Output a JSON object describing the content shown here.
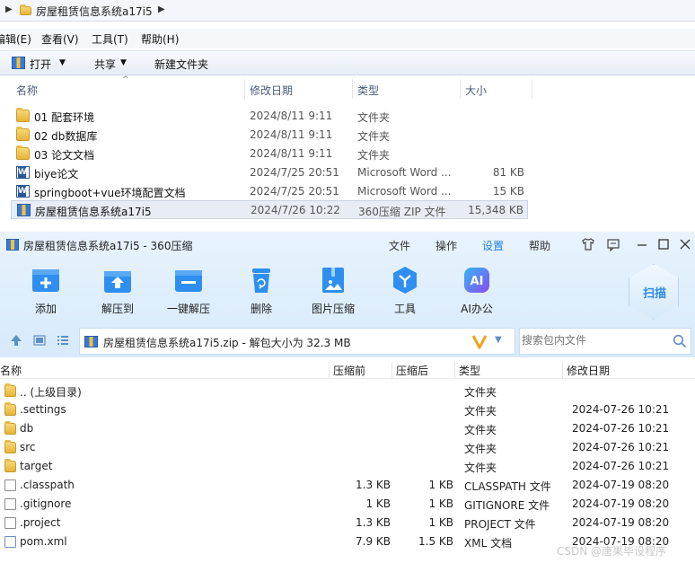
{
  "explorer": {
    "breadcrumb": "房屋租赁信息系统a17i5",
    "menu": [
      "编辑(E)",
      "查看(V)",
      "工具(T)",
      "帮助(H)"
    ],
    "toolbar": {
      "open": "打开",
      "share": "共享",
      "new_folder": "新建文件夹"
    },
    "columns": {
      "name": "名称",
      "date": "修改日期",
      "type": "类型",
      "size": "大小"
    },
    "rows": [
      {
        "icon": "folder",
        "name": "01 配套环境",
        "date": "2024/8/11 9:11",
        "type": "文件夹",
        "size": ""
      },
      {
        "icon": "folder",
        "name": "02 db数据库",
        "date": "2024/8/11 9:11",
        "type": "文件夹",
        "size": ""
      },
      {
        "icon": "folder",
        "name": "03 论文文档",
        "date": "2024/8/11 9:11",
        "type": "文件夹",
        "size": ""
      },
      {
        "icon": "word",
        "name": "biye论文",
        "date": "2024/7/25 20:51",
        "type": "Microsoft Word ...",
        "size": "81 KB"
      },
      {
        "icon": "word",
        "name": "springboot+vue环境配置文档",
        "date": "2024/7/25 20:51",
        "type": "Microsoft Word ...",
        "size": "15 KB"
      },
      {
        "icon": "zip",
        "name": "房屋租赁信息系统a17i5",
        "date": "2024/7/26 10:22",
        "type": "360压缩 ZIP 文件",
        "size": "15,348 KB"
      }
    ]
  },
  "z360": {
    "title": "房屋租赁信息系统a17i5 - 360压缩",
    "menu": {
      "file": "文件",
      "operate": "操作",
      "settings": "设置",
      "help": "帮助"
    },
    "tools": [
      {
        "label": "添加",
        "icon": "add-icon",
        "color": "#2f8ff0"
      },
      {
        "label": "解压到",
        "icon": "extract-to-icon",
        "color": "#2f8ff0"
      },
      {
        "label": "一键解压",
        "icon": "one-click-extract-icon",
        "color": "#2f8ff0"
      },
      {
        "label": "删除",
        "icon": "delete-icon",
        "color": "#2f8ff0"
      },
      {
        "label": "图片压缩",
        "icon": "image-compress-icon",
        "color": "#2f8ff0"
      },
      {
        "label": "工具",
        "icon": "tools-icon",
        "color": "#2f8ff0"
      },
      {
        "label": "AI办公",
        "icon": "ai-office-icon",
        "color": "#7b5cf5"
      }
    ],
    "scan": "扫描",
    "path": "房屋租赁信息系统a17i5.zip - 解包大小为 32.3 MB",
    "search_placeholder": "搜索包内文件",
    "columns": {
      "name": "名称",
      "before": "压缩前",
      "after": "压缩后",
      "type": "类型",
      "date": "修改日期"
    },
    "rows": [
      {
        "icon": "folder",
        "name": ".. (上级目录)",
        "before": "",
        "after": "",
        "type": "文件夹",
        "date": ""
      },
      {
        "icon": "folder",
        "name": ".settings",
        "before": "",
        "after": "",
        "type": "文件夹",
        "date": "2024-07-26 10:21"
      },
      {
        "icon": "folder",
        "name": "db",
        "before": "",
        "after": "",
        "type": "文件夹",
        "date": "2024-07-26 10:21"
      },
      {
        "icon": "folder",
        "name": "src",
        "before": "",
        "after": "",
        "type": "文件夹",
        "date": "2024-07-26 10:21"
      },
      {
        "icon": "folder",
        "name": "target",
        "before": "",
        "after": "",
        "type": "文件夹",
        "date": "2024-07-26 10:21"
      },
      {
        "icon": "file",
        "name": ".classpath",
        "before": "1.3 KB",
        "after": "1 KB",
        "type": "CLASSPATH 文件",
        "date": "2024-07-19 08:20"
      },
      {
        "icon": "file",
        "name": ".gitignore",
        "before": "1 KB",
        "after": "1 KB",
        "type": "GITIGNORE 文件",
        "date": "2024-07-19 08:20"
      },
      {
        "icon": "file",
        "name": ".project",
        "before": "1.3 KB",
        "after": "1 KB",
        "type": "PROJECT 文件",
        "date": "2024-07-19 08:20"
      },
      {
        "icon": "file",
        "name": "pom.xml",
        "before": "7.9 KB",
        "after": "1.5 KB",
        "type": "XML 文档",
        "date": "2024-07-19 08:20"
      }
    ],
    "watermark": "CSDN @唐果毕设程序"
  }
}
